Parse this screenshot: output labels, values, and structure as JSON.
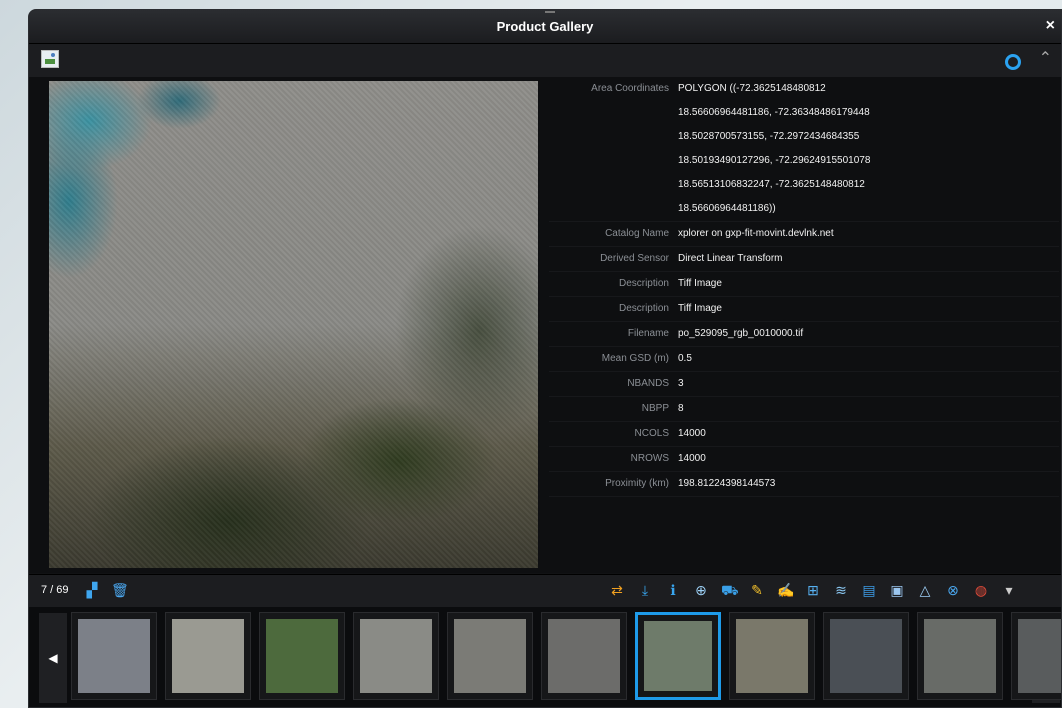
{
  "window": {
    "title": "Product Gallery",
    "close": "×"
  },
  "toolbar": {
    "collapse": "⌃"
  },
  "metadata": [
    {
      "key": "Area Coordinates",
      "value": [
        "POLYGON ((-72.3625148480812",
        "18.56606964481186, -72.36348486179448",
        "18.5028700573155, -72.2972434684355",
        "18.50193490127296, -72.29624915501078",
        "18.56513106832247, -72.3625148480812",
        "18.56606964481186))"
      ]
    },
    {
      "key": "Catalog Name",
      "value": [
        "xplorer on gxp-fit-movint.devlnk.net"
      ]
    },
    {
      "key": "Derived Sensor",
      "value": [
        "Direct Linear Transform"
      ]
    },
    {
      "key": "Description",
      "value": [
        "Tiff Image"
      ]
    },
    {
      "key": "Description",
      "value": [
        "Tiff Image"
      ]
    },
    {
      "key": "Filename",
      "value": [
        "po_529095_rgb_0010000.tif"
      ]
    },
    {
      "key": "Mean GSD (m)",
      "value": [
        "0.5"
      ]
    },
    {
      "key": "NBANDS",
      "value": [
        "3"
      ]
    },
    {
      "key": "NBPP",
      "value": [
        "8"
      ]
    },
    {
      "key": "NCOLS",
      "value": [
        "14000"
      ]
    },
    {
      "key": "NROWS",
      "value": [
        "14000"
      ]
    },
    {
      "key": "Proximity (km)",
      "value": [
        "198.81224398144573"
      ]
    }
  ],
  "bottombar": {
    "counter": "7 / 69",
    "tools": [
      {
        "name": "swap-icon",
        "glyph": "⇄",
        "color": "#f0a020"
      },
      {
        "name": "download-icon",
        "glyph": "⤓",
        "color": "#39a6ef"
      },
      {
        "name": "info-icon",
        "glyph": "ℹ",
        "color": "#39a6ef"
      },
      {
        "name": "globe-icon",
        "glyph": "⊕",
        "color": "#9dd0f5"
      },
      {
        "name": "cart-icon",
        "glyph": "⛟",
        "color": "#3aa0e8"
      },
      {
        "name": "pencil-icon",
        "glyph": "✎",
        "color": "#f3c02b"
      },
      {
        "name": "edit-document-icon",
        "glyph": "✍",
        "color": "#4fb0ef"
      },
      {
        "name": "add-layer-icon",
        "glyph": "⊞",
        "color": "#56b0f0"
      },
      {
        "name": "layers-icon",
        "glyph": "≋",
        "color": "#8ccaf5"
      },
      {
        "name": "bookmark-icon",
        "glyph": "▤",
        "color": "#3d9ce6"
      },
      {
        "name": "photos-icon",
        "glyph": "▣",
        "color": "#9bc6ef"
      },
      {
        "name": "triangle-icon",
        "glyph": "△",
        "color": "#9fd0f7"
      },
      {
        "name": "link-remove-icon",
        "glyph": "⊗",
        "color": "#4aa7ef"
      },
      {
        "name": "kml-icon",
        "glyph": "◍",
        "color": "#e24b3a"
      },
      {
        "name": "more-icon",
        "glyph": "▾",
        "color": "#cccccc"
      }
    ]
  },
  "strip": {
    "prev": "◀",
    "next": "▶",
    "thumbnails": [
      {
        "label": "thumb-1",
        "bg": "#7c8088"
      },
      {
        "label": "thumb-2",
        "bg": "#9a9a92"
      },
      {
        "label": "thumb-3",
        "bg": "#4d6a3d"
      },
      {
        "label": "thumb-4",
        "bg": "#8a8b86"
      },
      {
        "label": "thumb-5",
        "bg": "#7b7b76"
      },
      {
        "label": "thumb-6",
        "bg": "#6c6c6a"
      },
      {
        "label": "thumb-7",
        "bg": "#6e7b6a"
      },
      {
        "label": "thumb-8",
        "bg": "#7a786a"
      },
      {
        "label": "thumb-9",
        "bg": "#4a4f55"
      },
      {
        "label": "thumb-10",
        "bg": "#686b67"
      },
      {
        "label": "thumb-11",
        "bg": "#595c5d"
      }
    ]
  }
}
